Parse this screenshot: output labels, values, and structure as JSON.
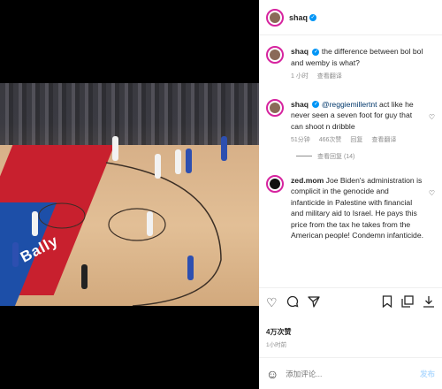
{
  "post": {
    "author": "shaq",
    "author_verified": true
  },
  "video": {
    "court_brand": "Bally",
    "mute_icon": "speaker-muted-icon"
  },
  "comments": [
    {
      "username": "shaq",
      "verified": true,
      "text": "the difference between bol bol and wemby is what?",
      "time": "1 小时",
      "translate": "查看翻译"
    },
    {
      "username": "shaq",
      "verified": true,
      "mention": "@reggiemillertnt",
      "text": "act like he never seen a seven foot for guy that can shoot n dribble",
      "time": "51分钟",
      "likes": "466次赞",
      "reply": "回复",
      "translate": "查看翻译",
      "view_replies": "查看回复 (14)"
    },
    {
      "username": "zed.mom",
      "verified": false,
      "text": "Joe Biden's administration is complicit in the genocide and infanticide in Palestine with financial and military aid to Israel. He pays this price from the tax he takes from the American people! Condemn infanticide."
    }
  ],
  "actions": {
    "like_icon": "heart-icon",
    "comment_icon": "comment-icon",
    "share_icon": "send-icon",
    "save_icon": "bookmark-icon",
    "copy_icon": "copy-icon",
    "download_icon": "download-icon"
  },
  "likes_count": "4万次赞",
  "date": "1小时前",
  "add_comment": {
    "placeholder": "添加评论...",
    "post_label": "发布"
  }
}
